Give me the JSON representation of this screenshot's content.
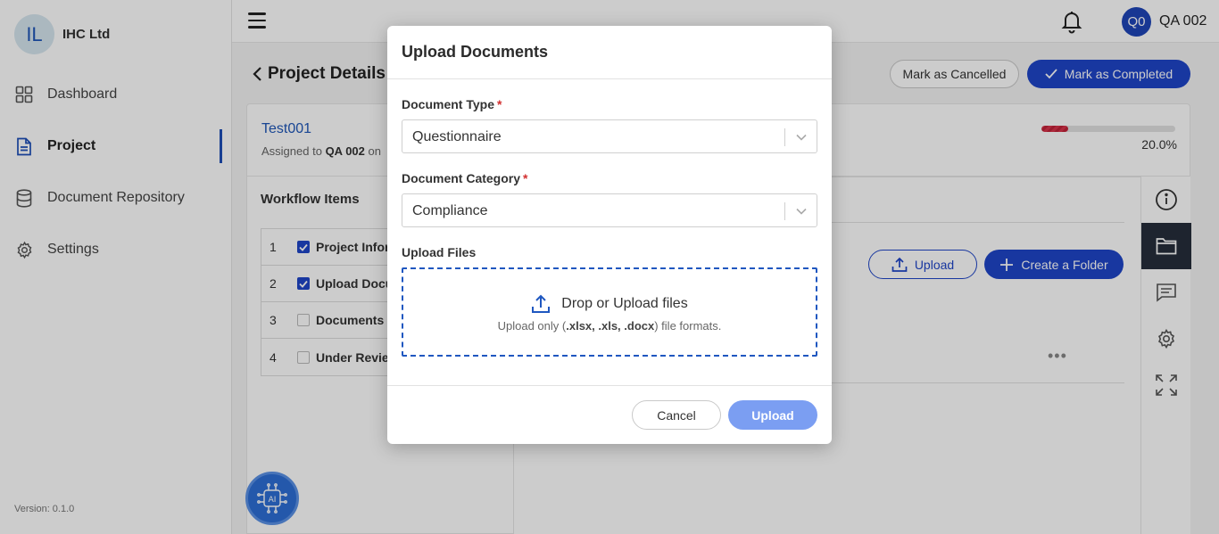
{
  "org": {
    "initials": "IL",
    "name": "IHC Ltd"
  },
  "sidebar": {
    "items": [
      {
        "label": "Dashboard",
        "icon": "grid-icon"
      },
      {
        "label": "Project",
        "icon": "document-icon"
      },
      {
        "label": "Document Repository",
        "icon": "database-icon"
      },
      {
        "label": "Settings",
        "icon": "gear-icon"
      }
    ],
    "version": "Version:  0.1.0"
  },
  "topbar": {
    "avatar_initials": "Q0",
    "user_name": "QA 002"
  },
  "page": {
    "title": "Project Details",
    "mark_cancelled": "Mark as Cancelled",
    "mark_completed": "Mark as Completed"
  },
  "project": {
    "name": "Test001",
    "assigned_prefix": "Assigned to",
    "assigned_user": "QA 002",
    "assigned_suffix": "on",
    "progress_fraction": 0.2,
    "progress_text": "20.0%"
  },
  "workflow": {
    "title": "Workflow Items",
    "items": [
      {
        "num": "1",
        "label": "Project Information",
        "checked": true
      },
      {
        "num": "2",
        "label": "Upload Documents",
        "checked": true
      },
      {
        "num": "3",
        "label": "Documents Review",
        "checked": false
      },
      {
        "num": "4",
        "label": "Under Review",
        "checked": false
      }
    ]
  },
  "content": {
    "upload_label": "Upload",
    "create_folder_label": "Create a Folder",
    "more": "•••"
  },
  "modal": {
    "title": "Upload Documents",
    "doc_type_label": "Document Type",
    "doc_type_value": "Questionnaire",
    "doc_category_label": "Document Category",
    "doc_category_value": "Compliance",
    "required_mark": "*",
    "upload_files_label": "Upload Files",
    "drop_text": "Drop or Upload files",
    "formats_prefix": "Upload only (",
    "formats": ".xlsx, .xls, .docx",
    "formats_suffix": ") file formats.",
    "cancel_label": "Cancel",
    "upload_label": "Upload"
  },
  "colors": {
    "primary": "#1f45c8",
    "upload_disabled": "#7b9ef2",
    "required": "#d23030"
  }
}
